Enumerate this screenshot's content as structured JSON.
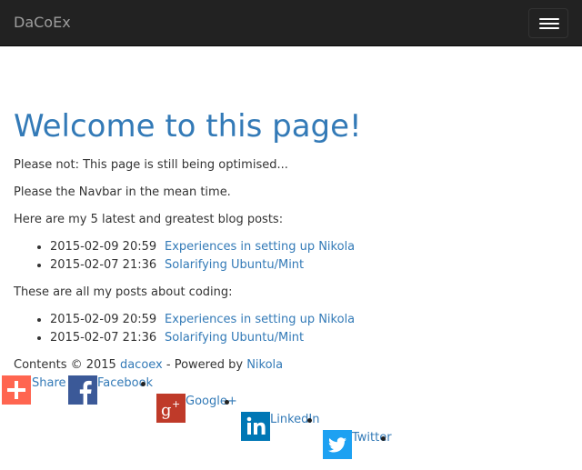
{
  "navbar": {
    "brand": "DaCoEx",
    "toggle_label": "Toggle navigation"
  },
  "main": {
    "heading": "Welcome to this page!",
    "notice": "Please not: This page is still being optimised...",
    "navbar_hint": "Please the Navbar in the mean time.",
    "latest_intro": "Here are my 5 latest and greatest blog posts:",
    "latest_posts": [
      {
        "date": "2015-02-09 20:59",
        "title": "Experiences in setting up Nikola"
      },
      {
        "date": "2015-02-07 21:36",
        "title": "Solarifying Ubuntu/Mint"
      }
    ],
    "coding_intro": "These are all my posts about coding:",
    "coding_posts": [
      {
        "date": "2015-02-09 20:59",
        "title": "Experiences in setting up Nikola"
      },
      {
        "date": "2015-02-07 21:36",
        "title": "Solarifying Ubuntu/Mint"
      }
    ]
  },
  "footer": {
    "prefix": "Contents © 2015 ",
    "author": "dacoex",
    "powered_by": " - Powered by ",
    "engine": "Nikola"
  },
  "share": {
    "items": [
      {
        "label": "Share",
        "icon": "plus-icon",
        "color": "#ff6550"
      },
      {
        "label": "Facebook",
        "icon": "facebook-icon",
        "color": "#3b5998"
      },
      {
        "label": "Google+",
        "icon": "google-plus-icon",
        "color": "#bf3a29"
      },
      {
        "label": "LinkedIn",
        "icon": "linkedin-icon",
        "color": "#0077b5"
      },
      {
        "label": "Twitter",
        "icon": "twitter-icon",
        "color": "#1da1f2"
      }
    ]
  }
}
